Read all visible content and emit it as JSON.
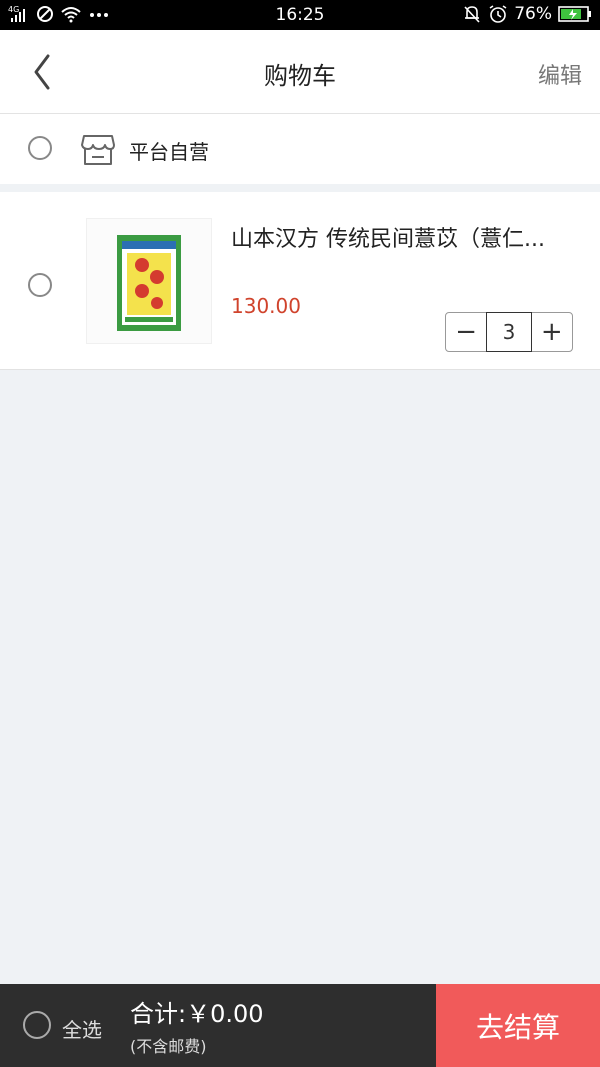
{
  "status_bar": {
    "network": "4G",
    "time": "16:25",
    "battery": "76%"
  },
  "header": {
    "title": "购物车",
    "edit_label": "编辑"
  },
  "store": {
    "name": "平台自营"
  },
  "cart_items": [
    {
      "title": "山本汉方 传统民间薏苡（薏仁...",
      "price": "130.00",
      "quantity": "3",
      "decrease_symbol": "−",
      "increase_symbol": "+"
    }
  ],
  "footer": {
    "select_all_label": "全选",
    "total_text": "合计:￥0.00",
    "shipping_note": "(不含邮费)",
    "checkout_label": "去结算"
  },
  "colors": {
    "price": "#d0432c",
    "checkout_button": "#f15a5a",
    "footer_bg": "#2e2e2e",
    "page_bg": "#eff2f5"
  },
  "icons": {
    "back": "chevron-left-icon",
    "store": "store-icon",
    "thumbnail": "product-image"
  }
}
